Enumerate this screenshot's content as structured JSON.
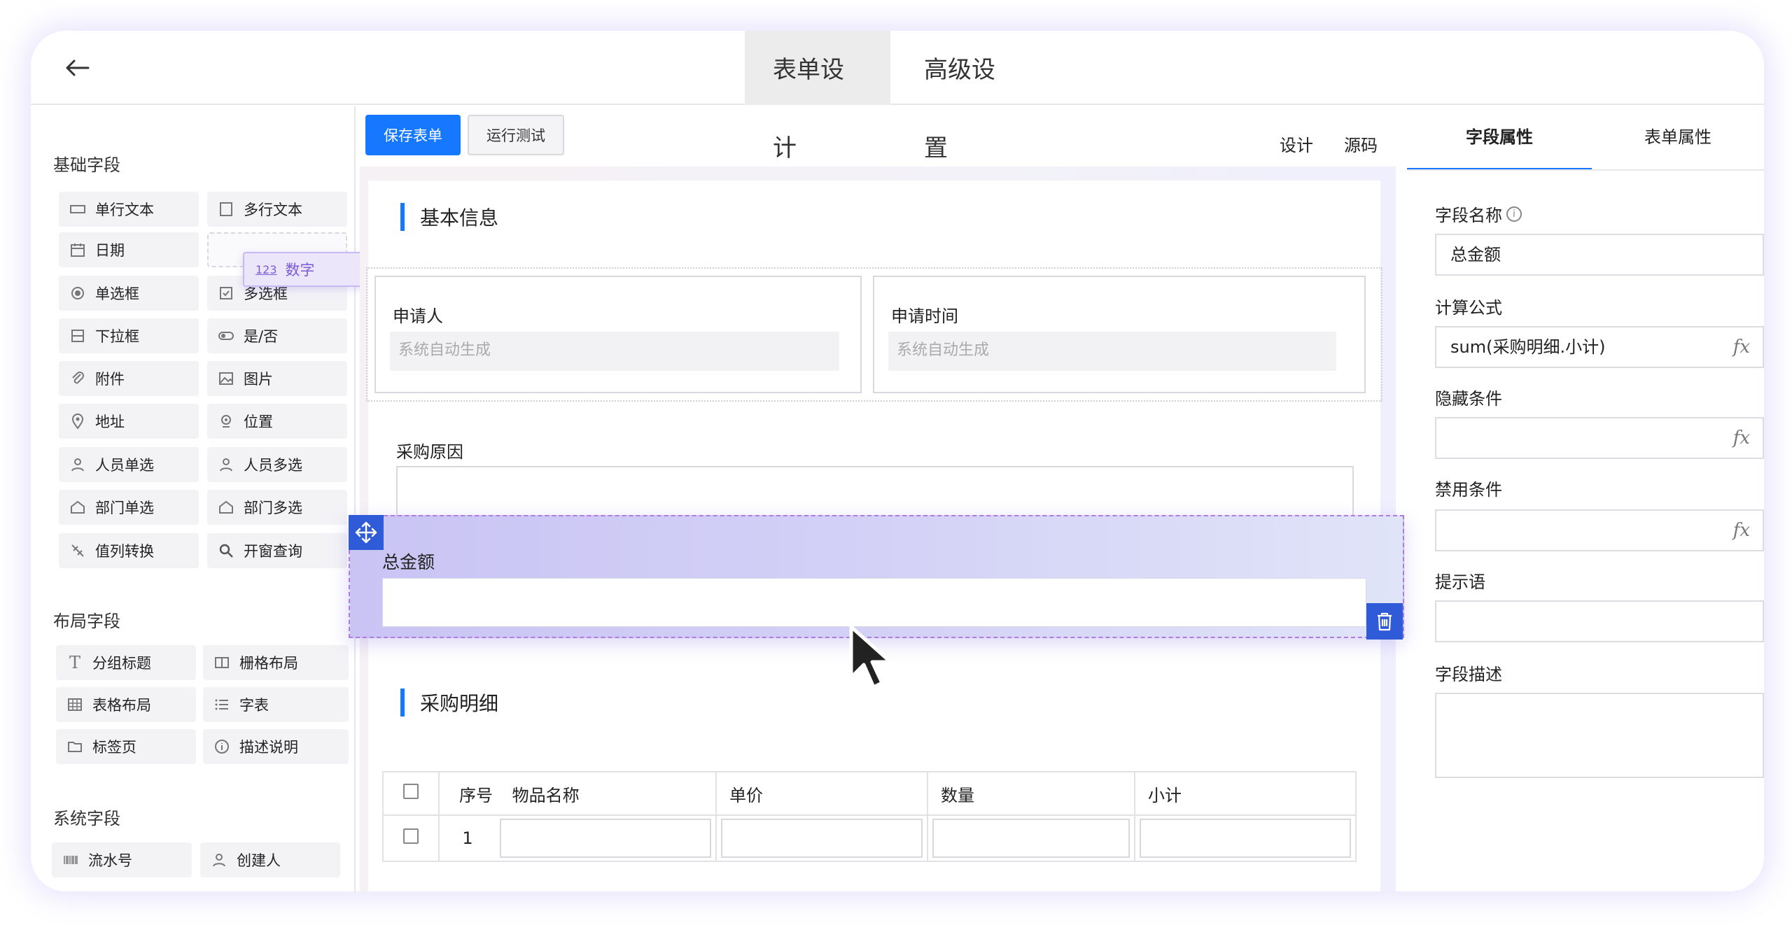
{
  "header": {
    "tabs": [
      "表单设计",
      "高级设置"
    ],
    "active_tab": "表单设计"
  },
  "sidebar": {
    "basic_title": "基础字段",
    "basic_fields": [
      "单行文本",
      "多行文本",
      "日期",
      "数字",
      "单选框",
      "多选框",
      "下拉框",
      "是/否",
      "附件",
      "图片",
      "地址",
      "位置",
      "人员单选",
      "人员多选",
      "部门单选",
      "部门多选",
      "值列转换",
      "开窗查询"
    ],
    "dragging_field": "数字",
    "dragging_icon_text": "123",
    "layout_title": "布局字段",
    "layout_fields": [
      "分组标题",
      "栅格布局",
      "表格布局",
      "字表",
      "标签页",
      "描述说明"
    ],
    "system_title": "系统字段",
    "system_fields": [
      "流水号",
      "创建人"
    ]
  },
  "toolbar": {
    "save_label": "保存表单",
    "test_label": "运行测试",
    "design_label": "设计",
    "source_label": "源码"
  },
  "form": {
    "section1_title": "基本信息",
    "applicant_label": "申请人",
    "applicant_placeholder": "系统自动生成",
    "apply_time_label": "申请时间",
    "apply_time_placeholder": "系统自动生成",
    "reason_label": "采购原因",
    "total_label": "总金额",
    "section2_title": "采购明细",
    "table_headers": [
      "序号",
      "物品名称",
      "单价",
      "数量",
      "小计"
    ],
    "rows": [
      {
        "index": "1"
      }
    ]
  },
  "right_panel": {
    "tabs": [
      "字段属性",
      "表单属性"
    ],
    "active_tab": "字段属性",
    "field_name_label": "字段名称",
    "field_name_value": "总金额",
    "formula_label": "计算公式",
    "formula_value": "sum(采购明细.小计)",
    "hidden_label": "隐藏条件",
    "disabled_label": "禁用条件",
    "hint_label": "提示语",
    "desc_label": "字段描述",
    "fx_text": "fx"
  },
  "colors": {
    "primary": "#1677ff",
    "drop_zone": "#cfcaf5",
    "handle": "#2f5bd8",
    "drag_ghost": "#ece6fb"
  }
}
